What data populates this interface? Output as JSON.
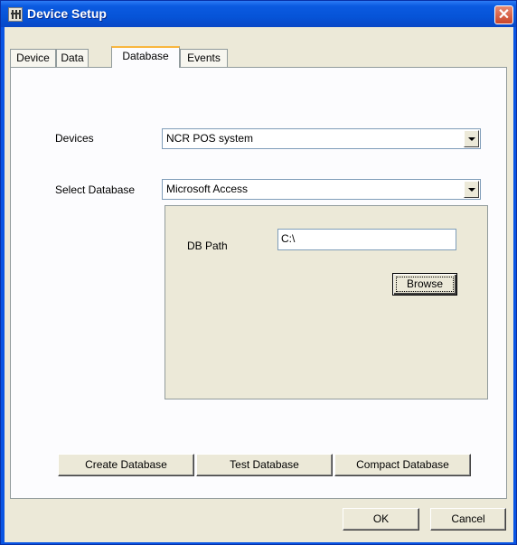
{
  "window": {
    "title": "Device Setup",
    "app_icon": "app-icon",
    "close_icon": "close-icon",
    "close_glyph": "✕"
  },
  "tabs": [
    {
      "label": "Device",
      "active": false
    },
    {
      "label": "Data",
      "active": false
    },
    {
      "label": "Database",
      "active": true
    },
    {
      "label": "Events",
      "active": false
    }
  ],
  "form": {
    "devices_label": "Devices",
    "devices_value": "NCR POS system",
    "select_db_label": "Select Database",
    "select_db_value": "Microsoft Access",
    "db_path_label": "DB Path",
    "db_path_value": "C:\\",
    "browse_label": "Browse"
  },
  "actions": {
    "create_label": "Create Database",
    "test_label": "Test Database",
    "compact_label": "Compact Database"
  },
  "footer": {
    "ok_label": "OK",
    "cancel_label": "Cancel"
  },
  "colors": {
    "titlebar": "#0654d8",
    "face": "#ece9d8",
    "tab_accent": "#f9b63e",
    "close": "#c9452a"
  }
}
